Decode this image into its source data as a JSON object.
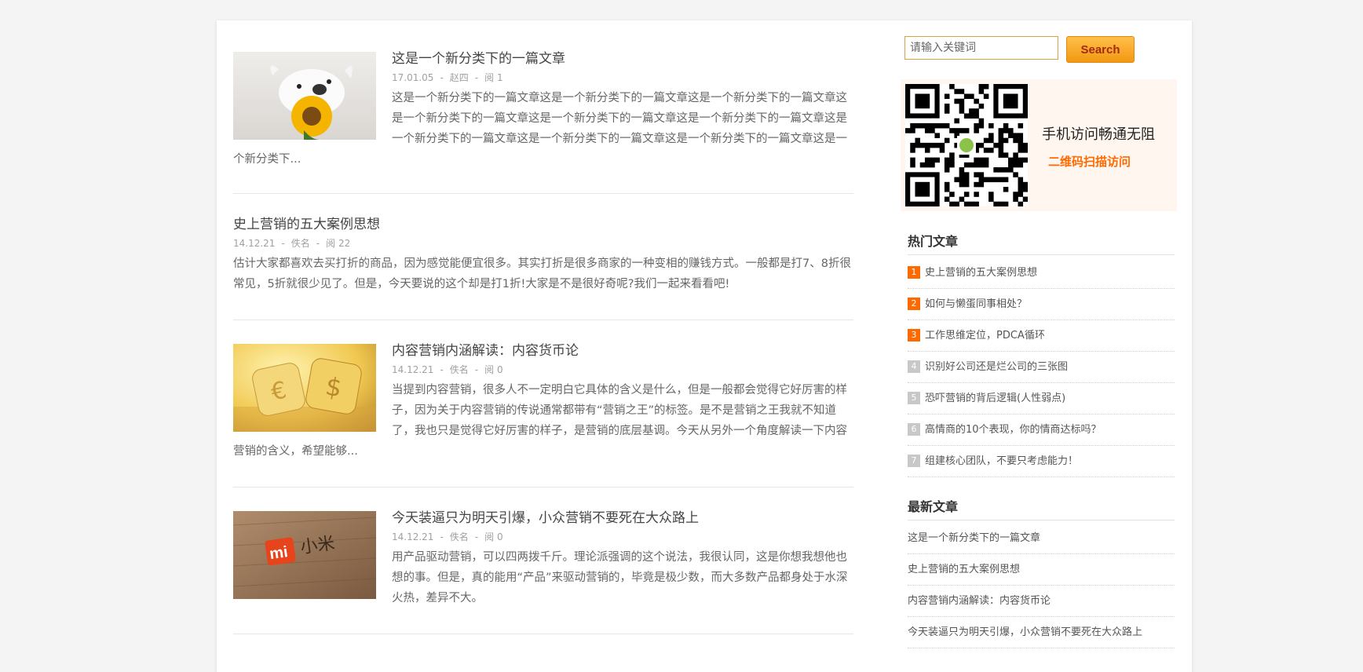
{
  "articles": [
    {
      "title": "这是一个新分类下的一篇文章",
      "date": "17.01.05",
      "author": "赵四",
      "views": "阅 1",
      "excerpt": "这是一个新分类下的一篇文章这是一个新分类下的一篇文章这是一个新分类下的一篇文章这是一个新分类下的一篇文章这是一个新分类下的一篇文章这是一个新分类下的一篇文章这是一个新分类下的一篇文章这是一个新分类下的一篇文章这是一个新分类下的一篇文章这是一个新分类下..."
    },
    {
      "title": "史上营销的五大案例思想",
      "date": "14.12.21",
      "author": "佚名",
      "views": "阅 22",
      "excerpt": "估计大家都喜欢去买打折的商品，因为感觉能便宜很多。其实打折是很多商家的一种变相的赚钱方式。一般都是打7、8折很常见，5折就很少见了。但是，今天要说的这个却是打1折!大家是不是很好奇呢?我们一起来看看吧!"
    },
    {
      "title": "内容营销内涵解读：内容货币论",
      "date": "14.12.21",
      "author": "佚名",
      "views": "阅 0",
      "excerpt": "当提到内容营销，很多人不一定明白它具体的含义是什么，但是一般都会觉得它好厉害的样子，因为关于内容营销的传说通常都带有“营销之王”的标签。是不是营销之王我就不知道了，我也只是觉得它好厉害的样子，是营销的底层基调。今天从另外一个角度解读一下内容营销的含义，希望能够..."
    },
    {
      "title": "今天装逼只为明天引爆，小众营销不要死在大众路上",
      "date": "14.12.21",
      "author": "佚名",
      "views": "阅 0",
      "excerpt": "用产品驱动营销，可以四两拨千斤。理论派强调的这个说法，我很认同，这是你想我想他也想的事。但是，真的能用“产品”来驱动营销的，毕竟是极少数，而大多数产品都身处于水深火热，差异不大。"
    }
  ],
  "meta_sep": "-",
  "search": {
    "placeholder": "请输入关键词",
    "button_label": "Search"
  },
  "qr": {
    "line1": "手机访问畅通无阻",
    "line2": "二维码扫描访问"
  },
  "hot": {
    "title": "热门文章",
    "items": [
      {
        "num": "1",
        "label": "史上营销的五大案例思想"
      },
      {
        "num": "2",
        "label": "如何与懒蛋同事相处？"
      },
      {
        "num": "3",
        "label": "工作思维定位，PDCA循环"
      },
      {
        "num": "4",
        "label": "识别好公司还是烂公司的三张图"
      },
      {
        "num": "5",
        "label": "恐吓营销的背后逻辑(人性弱点)"
      },
      {
        "num": "6",
        "label": "高情商的10个表现，你的情商达标吗？"
      },
      {
        "num": "7",
        "label": "组建核心团队，不要只考虑能力！"
      }
    ]
  },
  "latest": {
    "title": "最新文章",
    "items": [
      "这是一个新分类下的一篇文章",
      "史上营销的五大案例思想",
      "内容营销内涵解读：内容货币论",
      "今天装逼只为明天引爆，小众营销不要死在大众路上"
    ]
  },
  "colors": {
    "rank_top": "#ff6a00",
    "rank_other": "#c8c8c8",
    "accent_orange": "#f29812",
    "qr_bg": "#fff6f0"
  },
  "thumb_icons": [
    "dog-with-sunflower-image",
    "golden-dice-image",
    "xiaomi-logo-wood-image"
  ]
}
